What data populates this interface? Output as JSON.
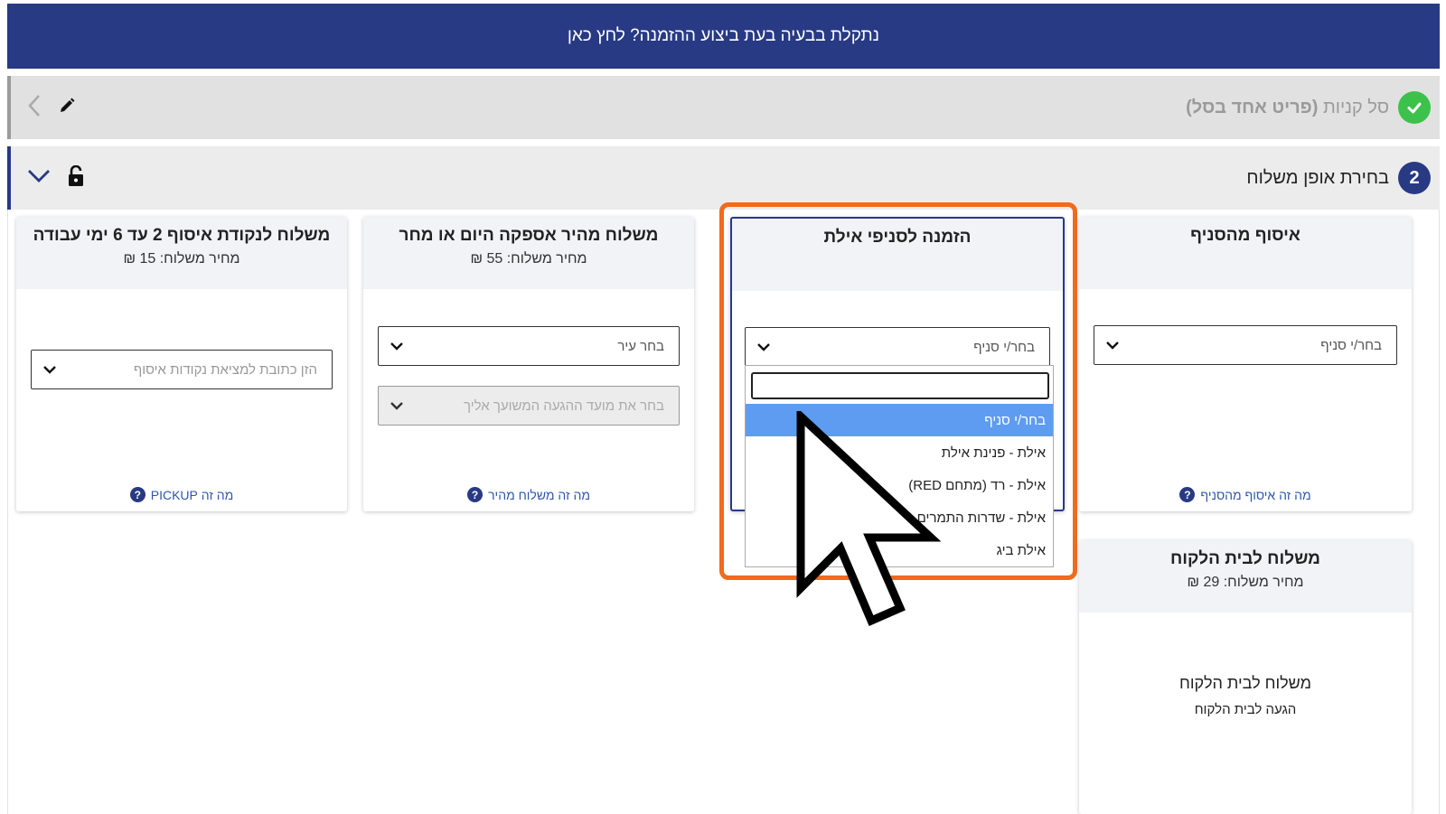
{
  "banner": {
    "text": "נתקלת בבעיה בעת ביצוע ההזמנה? לחץ כאן"
  },
  "step1": {
    "title": "סל קניות",
    "subtitle": "(פריט אחד בסל)"
  },
  "step2": {
    "number": "2",
    "title": "בחירת אופן משלוח"
  },
  "cards": {
    "pickup_point": {
      "title": "משלוח לנקודת איסוף 2 עד 6 ימי עבודה",
      "price": "מחיר משלוח: 15 ₪",
      "select_placeholder": "הזן כתובת למציאת נקודות איסוף",
      "help": "מה זה PICKUP"
    },
    "express": {
      "title": "משלוח מהיר אספקה היום או מחר",
      "price": "מחיר משלוח: 55 ₪",
      "city_placeholder": "בחר עיר",
      "time_placeholder": "בחר את מועד ההגעה המשועך אליך",
      "help": "מה זה משלוח מהיר"
    },
    "eilat": {
      "title": "הזמנה לסניפי אילת",
      "select_value": "בחר/י סניף"
    },
    "branch_pickup": {
      "title": "איסוף מהסניף",
      "select_value": "בחר/י סניף",
      "help": "מה זה איסוף מהסניף"
    },
    "home_delivery": {
      "title": "משלוח לבית הלקוח",
      "price": "מחיר משלוח: 29 ₪",
      "body_title": "משלוח לבית הלקוח",
      "body_sub": "הגעה לבית הלקוח"
    }
  },
  "dropdown": {
    "items": [
      "בחר/י סניף",
      "אילת - פנינת אילת",
      "אילת - רד (מתחם RED)",
      "אילת - שדרות התמרים",
      "אילת ביג"
    ]
  },
  "colors": {
    "navy": "#283a84",
    "accent": "#f26a1b",
    "success": "#3cc24a",
    "selected": "#5e9cf2"
  }
}
